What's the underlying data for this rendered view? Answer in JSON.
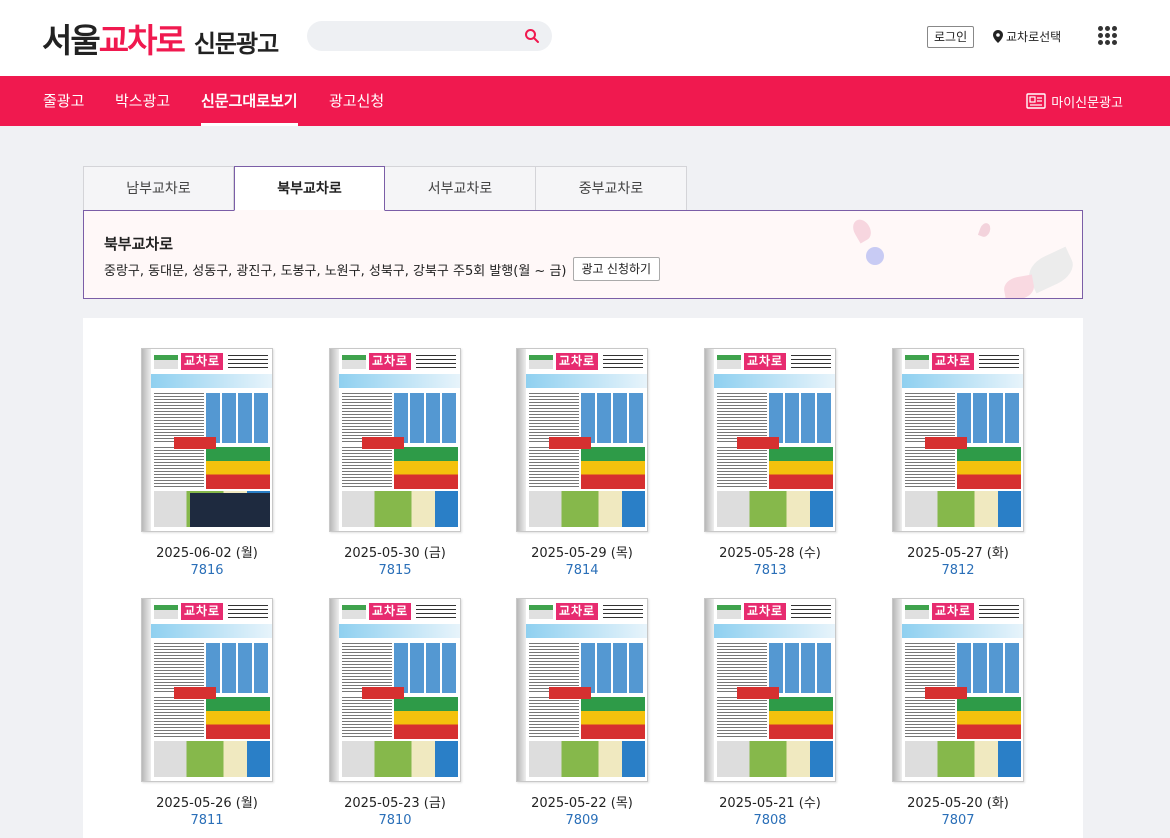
{
  "header": {
    "logo_main": "서울",
    "logo_accent": "교차로",
    "logo_sub": "신문광고",
    "search_placeholder": "",
    "login_label": "로그인",
    "region_label": "교차로선택"
  },
  "nav": {
    "items": [
      {
        "label": "줄광고"
      },
      {
        "label": "박스광고"
      },
      {
        "label": "신문그대로보기"
      },
      {
        "label": "광고신청"
      }
    ],
    "active_index": 2,
    "my_label": "마이신문광고"
  },
  "tabs": [
    {
      "label": "남부교차로"
    },
    {
      "label": "북부교차로"
    },
    {
      "label": "서부교차로"
    },
    {
      "label": "중부교차로"
    }
  ],
  "active_tab": 1,
  "info": {
    "title": "북부교차로",
    "description": "중랑구, 동대문, 성동구, 광진구, 도봉구, 노원구, 성북구, 강북구 주5회 발행(월 ~ 금)",
    "apply_label": "광고 신청하기"
  },
  "papers": [
    {
      "date": "2025-06-02 (월)",
      "number": "7816",
      "masthead": "교차로"
    },
    {
      "date": "2025-05-30 (금)",
      "number": "7815",
      "masthead": "교차로"
    },
    {
      "date": "2025-05-29 (목)",
      "number": "7814",
      "masthead": "교차로"
    },
    {
      "date": "2025-05-28 (수)",
      "number": "7813",
      "masthead": "교차로"
    },
    {
      "date": "2025-05-27 (화)",
      "number": "7812",
      "masthead": "교차로"
    },
    {
      "date": "2025-05-26 (월)",
      "number": "7811",
      "masthead": "교차로"
    },
    {
      "date": "2025-05-23 (금)",
      "number": "7810",
      "masthead": "교차로"
    },
    {
      "date": "2025-05-22 (목)",
      "number": "7809",
      "masthead": "교차로"
    },
    {
      "date": "2025-05-21 (수)",
      "number": "7808",
      "masthead": "교차로"
    },
    {
      "date": "2025-05-20 (화)",
      "number": "7807",
      "masthead": "교차로"
    }
  ],
  "colors": {
    "brand": "#f0194f",
    "tab_border": "#7b5ea7",
    "link": "#2a6fb8"
  }
}
